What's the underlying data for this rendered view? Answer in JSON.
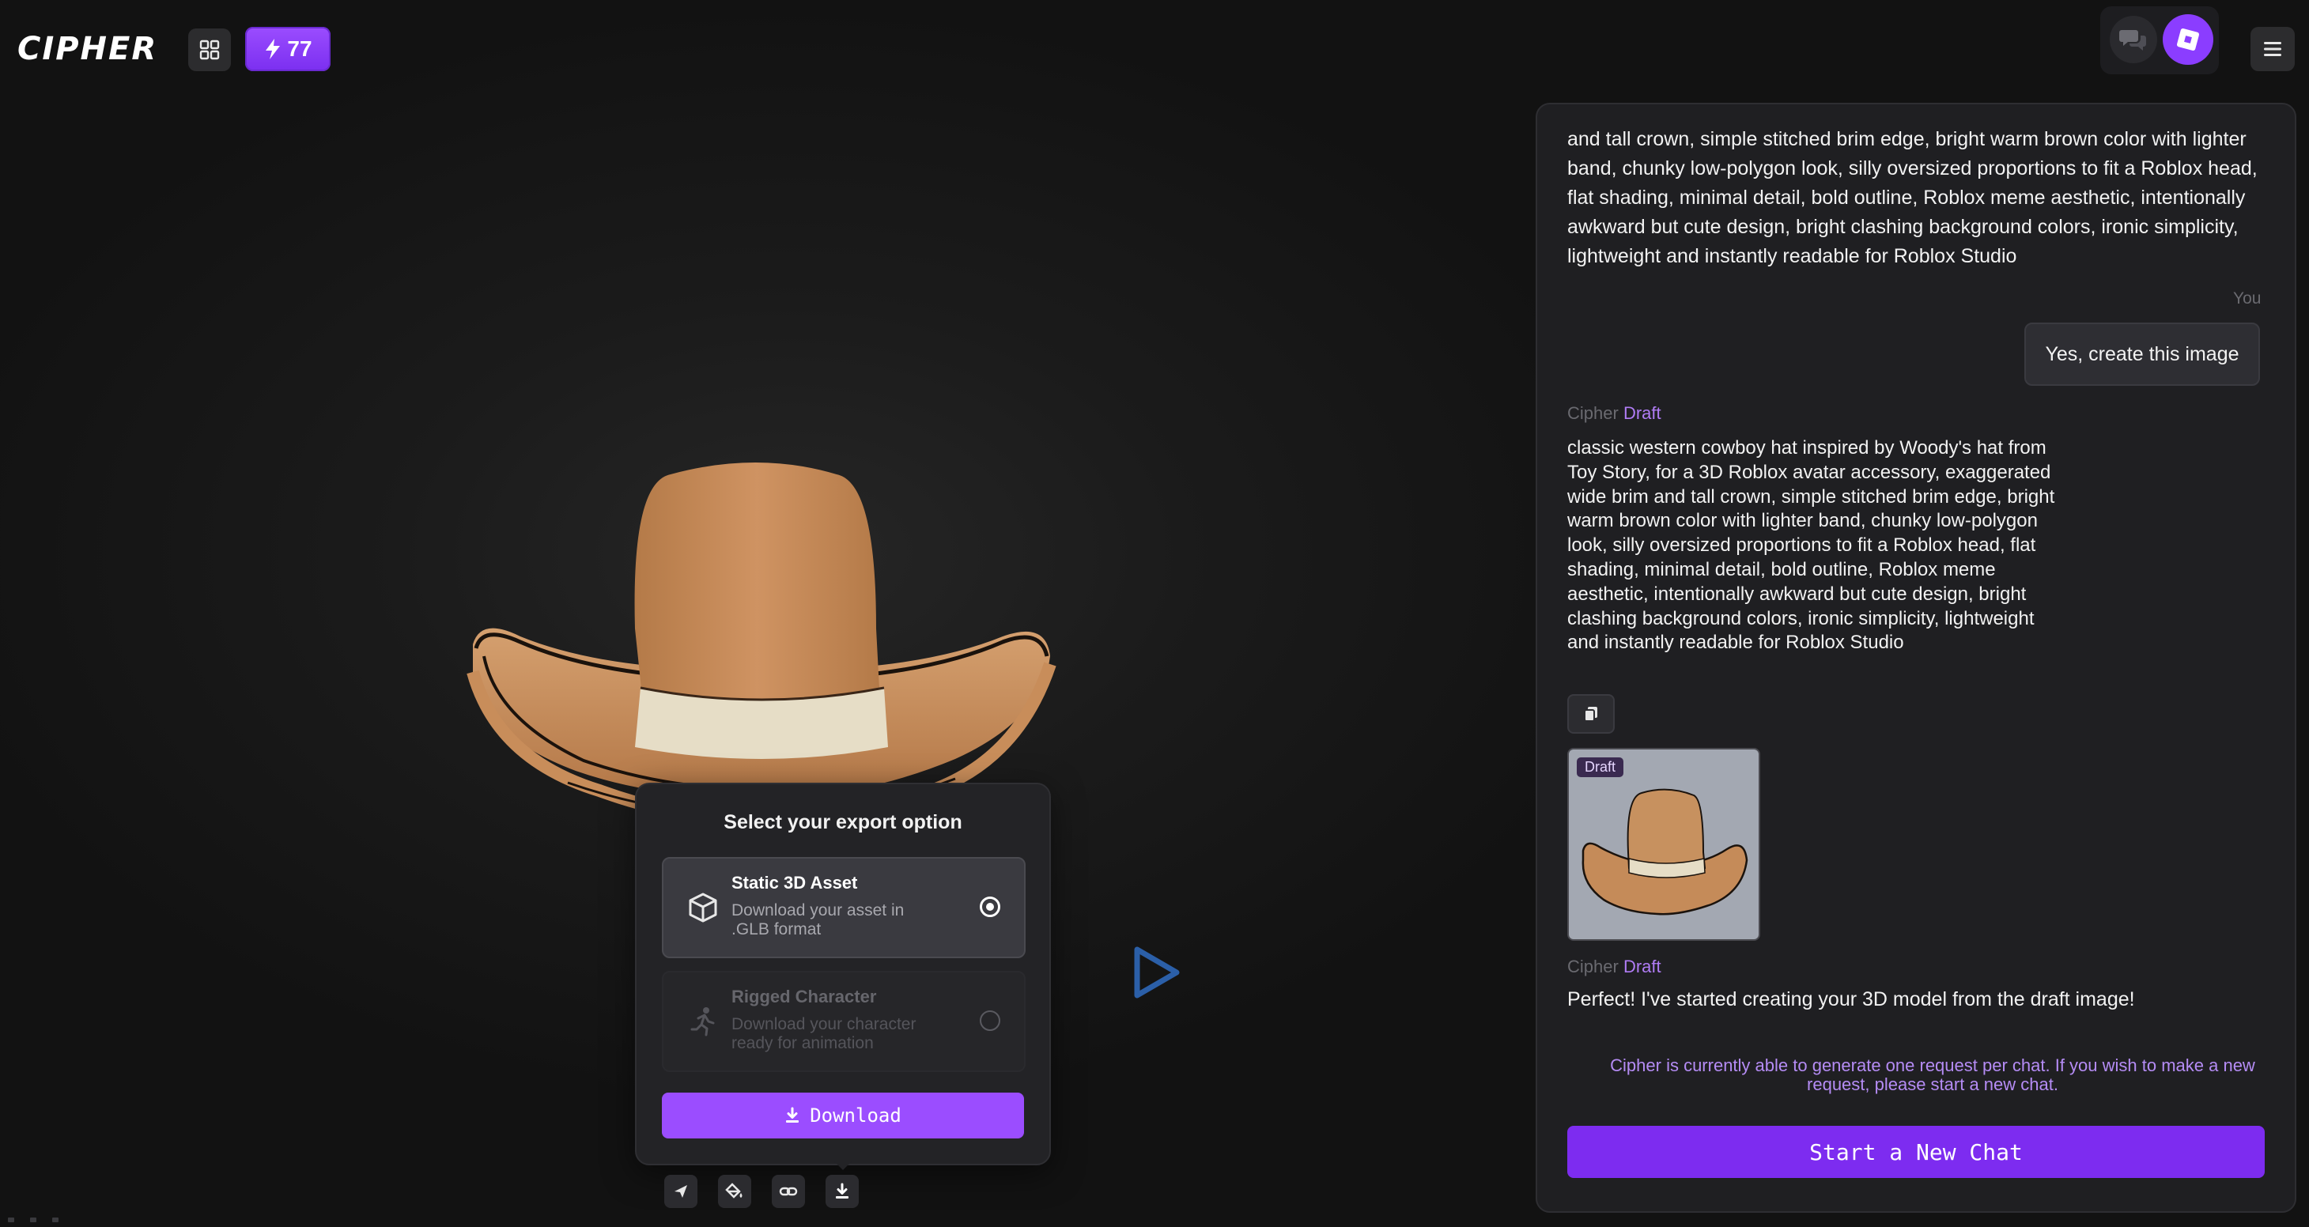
{
  "header": {
    "logo_text": "CIPHER",
    "credits_count": "77",
    "icons": {
      "apps": "grid-icon",
      "credits": "lightning-icon",
      "chats": "chat-bubbles-icon",
      "roblox": "roblox-logo-icon",
      "menu": "hamburger-icon"
    }
  },
  "colors": {
    "accent": "#9b4dff",
    "accent_dark": "#7d2cf0",
    "draft_tag": "#b07cf5",
    "hat_brown": "#c78a55",
    "hat_band": "#e6ddc6"
  },
  "export_panel": {
    "title": "Select your export option",
    "options": [
      {
        "title": "Static 3D Asset",
        "description": "Download your asset in .GLB format",
        "selected": true,
        "icon": "cube-icon"
      },
      {
        "title": "Rigged Character",
        "description": "Download your character ready for animation",
        "selected": false,
        "icon": "running-figure-icon"
      }
    ],
    "download_label": "Download"
  },
  "bottom_toolbar": [
    "send-icon",
    "paint-bucket-icon",
    "link-icon",
    "download-icon"
  ],
  "chat": {
    "top_message_tail": "and tall crown, simple stitched brim edge, bright warm brown color with lighter band, chunky low-polygon look, silly oversized proportions to fit a Roblox head, flat shading, minimal detail, bold outline, Roblox meme aesthetic, intentionally awkward but cute design, bright clashing background colors, ironic simplicity, lightweight and instantly readable for Roblox Studio",
    "you_label": "You",
    "user_message": "Yes, create this image",
    "sender_name": "Cipher",
    "draft_tag": "Draft",
    "draft_prompt": "classic western cowboy hat inspired by Woody's hat from Toy Story, for a 3D Roblox avatar accessory, exaggerated wide brim and tall crown, simple stitched brim edge, bright warm brown color with lighter band, chunky low-polygon look, silly oversized proportions to fit a Roblox head, flat shading, minimal detail, bold outline, Roblox meme aesthetic, intentionally awkward but cute design, bright clashing background colors, ironic simplicity, lightweight and instantly readable for Roblox Studio",
    "thumbnail_badge": "Draft",
    "reply": "Perfect! I've started creating your 3D model from the draft image!",
    "notice": "Cipher is currently able to generate one request per chat. If you wish to make a new request, please start a new chat.",
    "new_chat_label": "Start a New Chat"
  }
}
